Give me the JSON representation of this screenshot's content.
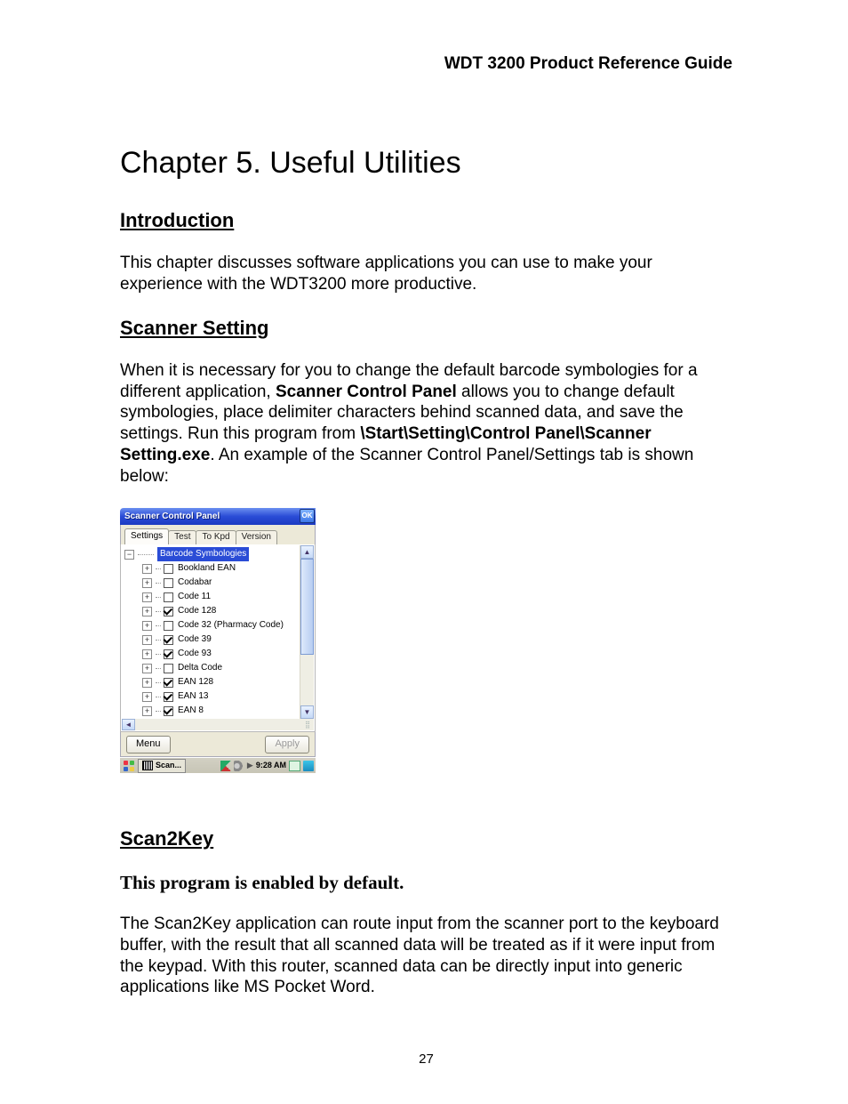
{
  "running_header": "WDT 3200 Product Reference Guide",
  "chapter_title": "Chapter 5. Useful Utilities",
  "intro": {
    "heading": "Introduction",
    "para": "This chapter discusses software applications you can use to make your experience with the WDT3200 more productive."
  },
  "scanner": {
    "heading": "Scanner Setting",
    "para1_a": "When it is necessary for you to change the default barcode symbologies for a different application, ",
    "para1_b": "Scanner Control Panel",
    "para1_c": " allows you to change default symbologies, place delimiter characters behind scanned data, and save the settings. Run this program from ",
    "para1_d": "\\Start\\Setting\\Control Panel\\Scanner Setting.exe",
    "para1_e": ".   An example of the Scanner Control Panel/Settings tab is shown below:"
  },
  "scp": {
    "title": "Scanner Control Panel",
    "ok": "OK",
    "tabs": [
      "Settings",
      "Test",
      "To Kpd",
      "Version"
    ],
    "root": "Barcode Symbologies",
    "items": [
      {
        "label": "Bookland EAN",
        "checked": false
      },
      {
        "label": "Codabar",
        "checked": false
      },
      {
        "label": "Code 11",
        "checked": false
      },
      {
        "label": "Code 128",
        "checked": true
      },
      {
        "label": "Code 32 (Pharmacy Code)",
        "checked": false
      },
      {
        "label": "Code 39",
        "checked": true
      },
      {
        "label": "Code 93",
        "checked": true
      },
      {
        "label": "Delta Code",
        "checked": false
      },
      {
        "label": "EAN 128",
        "checked": true
      },
      {
        "label": "EAN 13",
        "checked": true
      },
      {
        "label": "EAN 8",
        "checked": true
      }
    ],
    "menu": "Menu",
    "apply": "Apply",
    "task_label": "Scan...",
    "clock": "9:28 AM"
  },
  "scan2key": {
    "heading": "Scan2Key",
    "sub": "This program is enabled by default.",
    "para": "The Scan2Key application can route input from the scanner port to the keyboard buffer, with the result that all scanned data will be treated as if it were input from the keypad.   With this router, scanned data can be directly input into generic applications like MS Pocket Word."
  },
  "page_number": "27"
}
